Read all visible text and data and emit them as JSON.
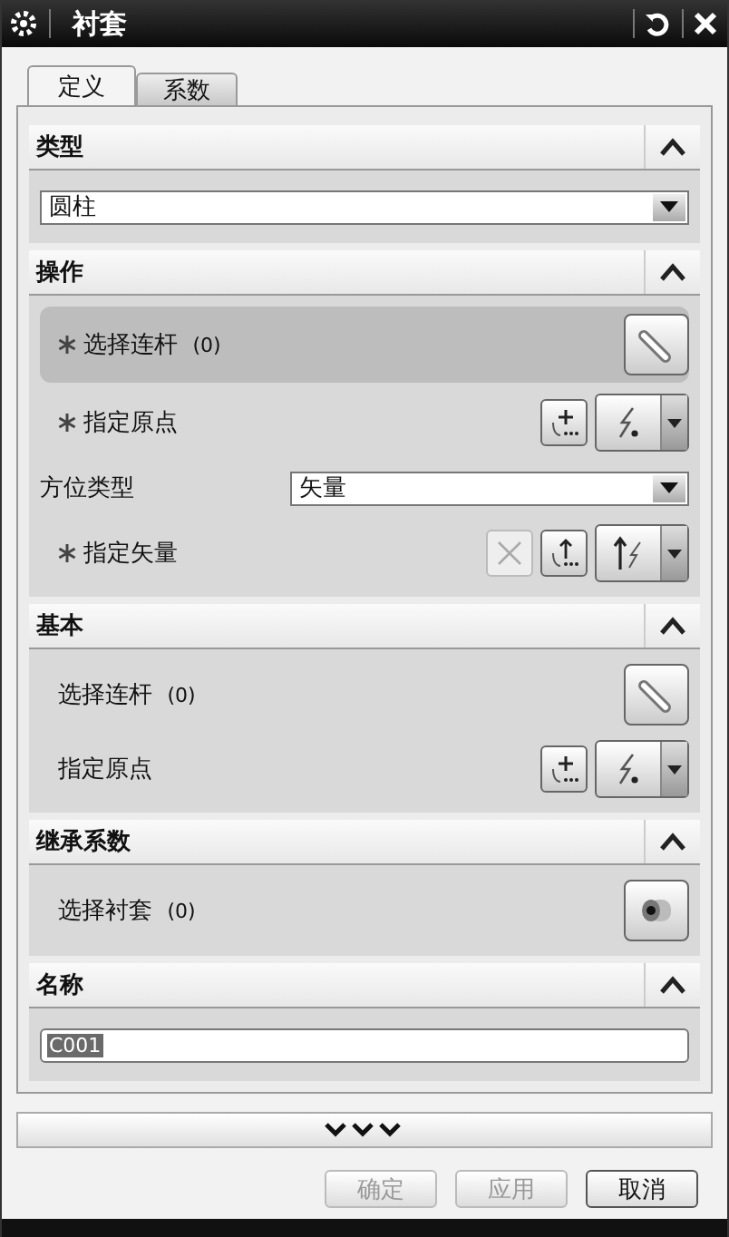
{
  "window": {
    "title": "衬套"
  },
  "tabs": [
    {
      "label": "定义",
      "selected": true
    },
    {
      "label": "系数",
      "selected": false
    }
  ],
  "sections": [
    {
      "title": "类型",
      "expanded": true,
      "rows": [
        {
          "kind": "dropdown",
          "value": "圆柱"
        }
      ]
    },
    {
      "title": "操作",
      "expanded": true,
      "rows": [
        {
          "kind": "select-link",
          "required": true,
          "highlighted": true,
          "label": "选择连杆",
          "count": "(0)"
        },
        {
          "kind": "point",
          "required": true,
          "label": "指定原点"
        },
        {
          "kind": "labeled-dropdown",
          "label": "方位类型",
          "value": "矢量"
        },
        {
          "kind": "vector",
          "required": true,
          "label": "指定矢量"
        }
      ]
    },
    {
      "title": "基本",
      "expanded": true,
      "rows": [
        {
          "kind": "select-link",
          "required": false,
          "highlighted": false,
          "label": "选择连杆",
          "count": "(0)"
        },
        {
          "kind": "point",
          "required": false,
          "label": "指定原点"
        }
      ]
    },
    {
      "title": "继承系数",
      "expanded": true,
      "rows": [
        {
          "kind": "select-bushing",
          "required": false,
          "highlighted": false,
          "label": "选择衬套",
          "count": "(0)"
        }
      ]
    },
    {
      "title": "名称",
      "expanded": true,
      "rows": [
        {
          "kind": "text",
          "value": "C001",
          "text_selected": true
        }
      ]
    }
  ],
  "buttons": [
    {
      "label": "确定",
      "disabled": true
    },
    {
      "label": "应用",
      "disabled": true
    },
    {
      "label": "取消",
      "disabled": false
    }
  ]
}
